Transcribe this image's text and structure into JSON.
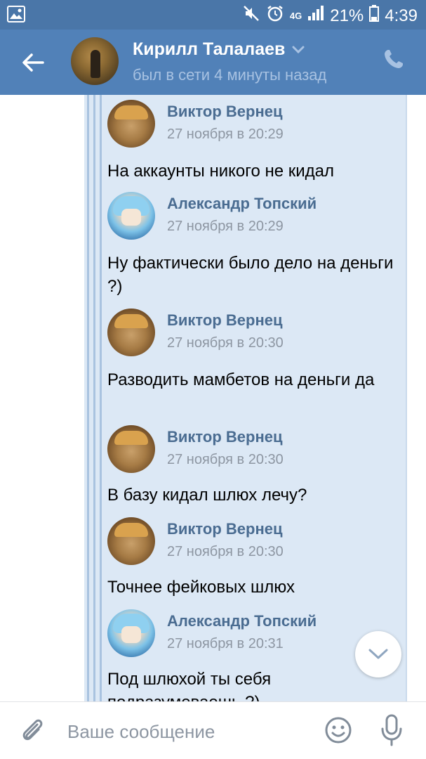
{
  "status_bar": {
    "network": "4G",
    "battery": "21%",
    "time": "4:39"
  },
  "header": {
    "contact_name": "Кирилл Талалаев",
    "contact_status": "был в сети 4 минуты назад"
  },
  "messages": [
    {
      "sender": "Виктор Вернец",
      "time": "27 ноября в 20:29",
      "text": "На аккаунты никого не кидал"
    },
    {
      "sender": "Александр Топский",
      "time": "27 ноября в 20:29",
      "text": "Ну фактически было дело на деньги ?)"
    },
    {
      "sender": "Виктор Вернец",
      "time": "27 ноября в 20:30",
      "text": "Разводить мамбетов на деньги да"
    },
    {
      "sender": "Виктор Вернец",
      "time": "27 ноября в 20:30",
      "text": "В базу кидал шлюх лечу?"
    },
    {
      "sender": "Виктор Вернец",
      "time": "27 ноября в 20:30",
      "text": "Точнее фейковых шлюх"
    },
    {
      "sender": "Александр Топский",
      "time": "27 ноября в 20:31",
      "text": "Под шлюхой ты себя подразумеваешь ?)"
    }
  ],
  "input": {
    "placeholder": "Ваше сообщение"
  },
  "icons": {
    "back": "arrow-left-icon",
    "dropdown": "chevron-down-icon",
    "call": "phone-icon",
    "scroll_down": "chevron-down-icon",
    "attach": "paperclip-icon",
    "emoji": "smiley-icon",
    "mic": "microphone-icon"
  },
  "colors": {
    "header": "#5181b8",
    "status_bar": "#4a76a8",
    "forward_block": "#dce8f5",
    "sender_name": "#4a6c91",
    "timestamp": "#8d96a2"
  }
}
